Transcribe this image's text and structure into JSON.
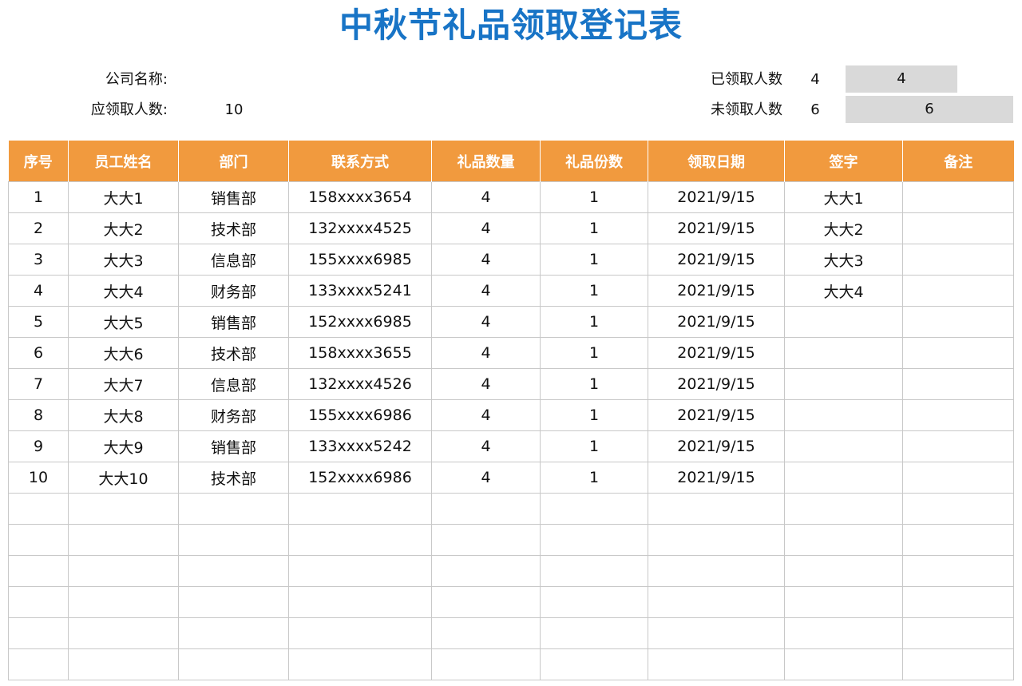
{
  "title": "中秋节礼品领取登记表",
  "info": {
    "company_label": "公司名称:",
    "company_value": "",
    "expected_label": "应领取人数:",
    "expected_value": "10",
    "received_label": "已领取人数",
    "received_value": "4",
    "received_box": "4",
    "unreceived_label": "未领取人数",
    "unreceived_value": "6",
    "unreceived_box": "6"
  },
  "table": {
    "headers": [
      "序号",
      "员工姓名",
      "部门",
      "联系方式",
      "礼品数量",
      "礼品份数",
      "领取日期",
      "签字",
      "备注"
    ],
    "rows": [
      [
        "1",
        "大大1",
        "销售部",
        "158xxxx3654",
        "4",
        "1",
        "2021/9/15",
        "大大1",
        ""
      ],
      [
        "2",
        "大大2",
        "技术部",
        "132xxxx4525",
        "4",
        "1",
        "2021/9/15",
        "大大2",
        ""
      ],
      [
        "3",
        "大大3",
        "信息部",
        "155xxxx6985",
        "4",
        "1",
        "2021/9/15",
        "大大3",
        ""
      ],
      [
        "4",
        "大大4",
        "财务部",
        "133xxxx5241",
        "4",
        "1",
        "2021/9/15",
        "大大4",
        ""
      ],
      [
        "5",
        "大大5",
        "销售部",
        "152xxxx6985",
        "4",
        "1",
        "2021/9/15",
        "",
        ""
      ],
      [
        "6",
        "大大6",
        "技术部",
        "158xxxx3655",
        "4",
        "1",
        "2021/9/15",
        "",
        ""
      ],
      [
        "7",
        "大大7",
        "信息部",
        "132xxxx4526",
        "4",
        "1",
        "2021/9/15",
        "",
        ""
      ],
      [
        "8",
        "大大8",
        "财务部",
        "155xxxx6986",
        "4",
        "1",
        "2021/9/15",
        "",
        ""
      ],
      [
        "9",
        "大大9",
        "销售部",
        "133xxxx5242",
        "4",
        "1",
        "2021/9/15",
        "",
        ""
      ],
      [
        "10",
        "大大10",
        "技术部",
        "152xxxx6986",
        "4",
        "1",
        "2021/9/15",
        "",
        ""
      ],
      [
        "",
        "",
        "",
        "",
        "",
        "",
        "",
        "",
        ""
      ],
      [
        "",
        "",
        "",
        "",
        "",
        "",
        "",
        "",
        ""
      ],
      [
        "",
        "",
        "",
        "",
        "",
        "",
        "",
        "",
        ""
      ],
      [
        "",
        "",
        "",
        "",
        "",
        "",
        "",
        "",
        ""
      ],
      [
        "",
        "",
        "",
        "",
        "",
        "",
        "",
        "",
        ""
      ],
      [
        "",
        "",
        "",
        "",
        "",
        "",
        "",
        "",
        ""
      ]
    ]
  },
  "colors": {
    "title": "#1874c6",
    "header_bg": "#f19a3e",
    "summary_box_bg": "#d9d9d9"
  }
}
